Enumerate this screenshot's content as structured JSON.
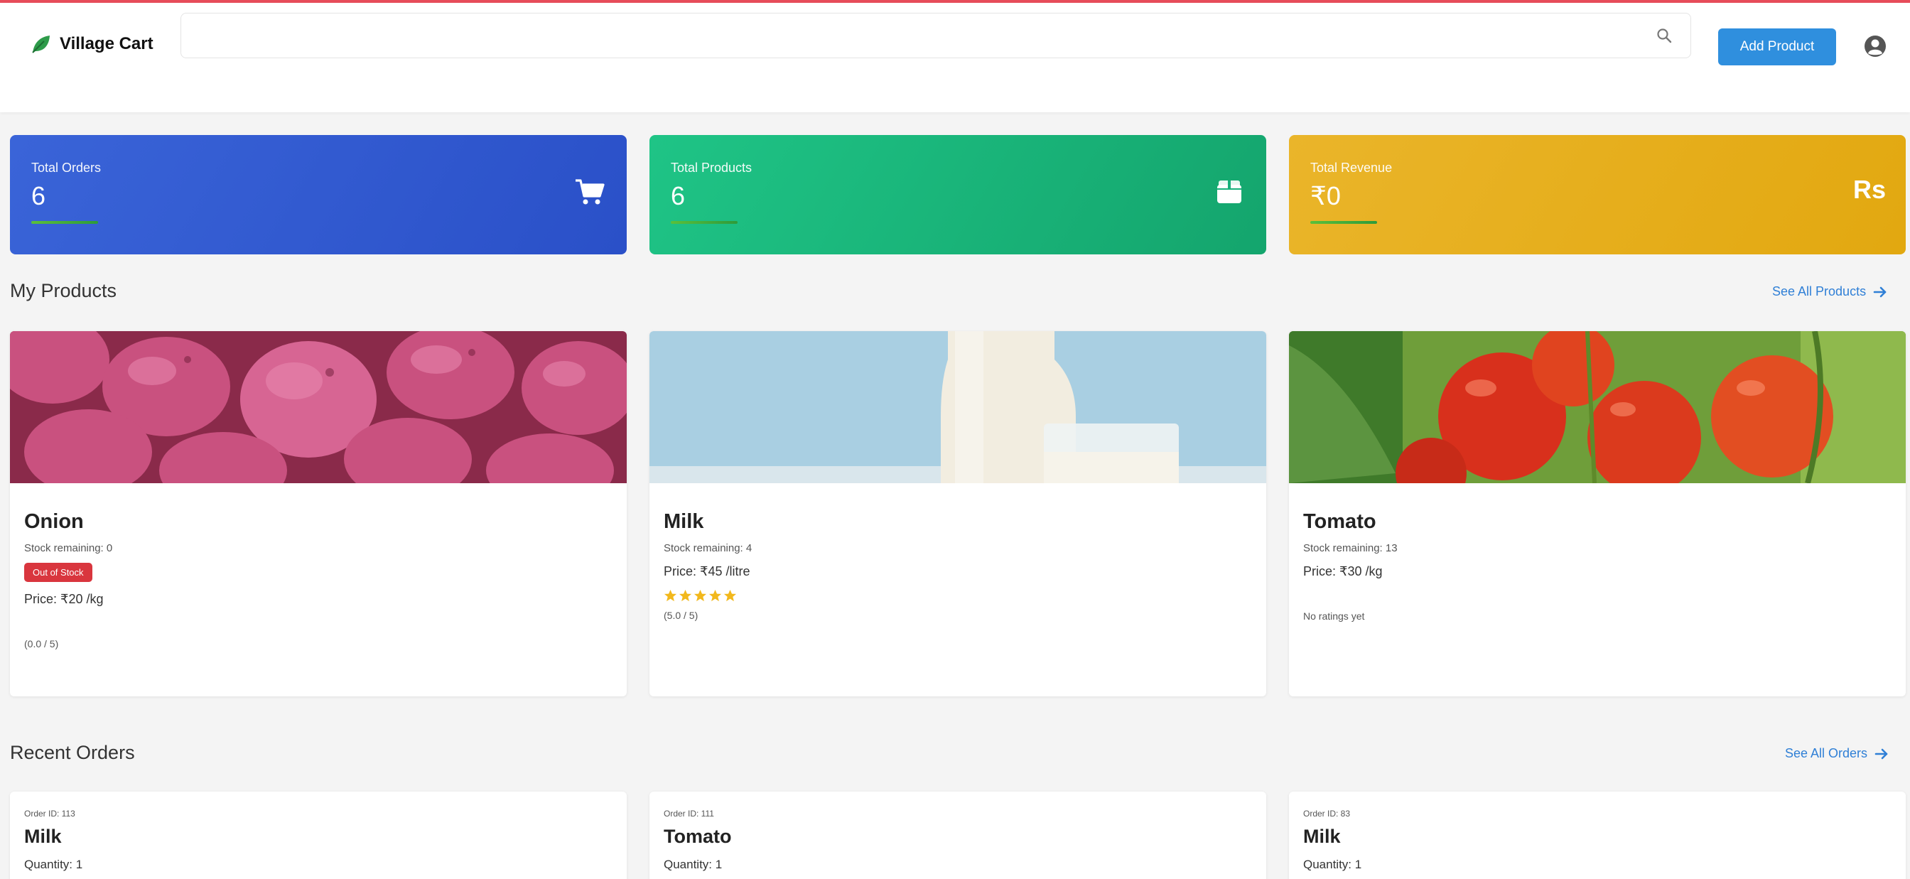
{
  "header": {
    "brand_name": "Village Cart",
    "search_placeholder": "",
    "add_product_label": "Add Product"
  },
  "stats": [
    {
      "label": "Total Orders",
      "value": "6",
      "icon": "cart-icon"
    },
    {
      "label": "Total Products",
      "value": "6",
      "icon": "box-icon"
    },
    {
      "label": "Total Revenue",
      "value": "₹0",
      "icon_text": "Rs"
    }
  ],
  "products_section": {
    "title": "My Products",
    "see_all": "See All Products"
  },
  "products": [
    {
      "name": "Onion",
      "stock": "Stock remaining: 0",
      "badge": "Out of Stock",
      "price": "Price: ₹20 /kg",
      "rating": "(0.0 / 5)",
      "stars": 0,
      "image": "onion-image"
    },
    {
      "name": "Milk",
      "stock": "Stock remaining: 4",
      "price": "Price: ₹45 /litre",
      "rating": "(5.0 / 5)",
      "stars": 5,
      "image": "milk-image"
    },
    {
      "name": "Tomato",
      "stock": "Stock remaining: 13",
      "price": "Price: ₹30 /kg",
      "rating": "No ratings yet",
      "stars": 0,
      "image": "tomato-image"
    }
  ],
  "orders_section": {
    "title": "Recent Orders",
    "see_all": "See All Orders"
  },
  "orders": [
    {
      "id": "Order ID: 113",
      "name": "Milk",
      "quantity": "Quantity: 1"
    },
    {
      "id": "Order ID: 111",
      "name": "Tomato",
      "quantity": "Quantity: 1"
    },
    {
      "id": "Order ID: 83",
      "name": "Milk",
      "quantity": "Quantity: 1"
    }
  ],
  "colors": {
    "primary_button": "#2f8fde",
    "orders_card": "#3a64d8",
    "products_card": "#1fc486",
    "revenue_card": "#eab52a",
    "out_of_stock": "#d9363e",
    "link": "#2f7fd6",
    "star": "#f2b81c"
  }
}
